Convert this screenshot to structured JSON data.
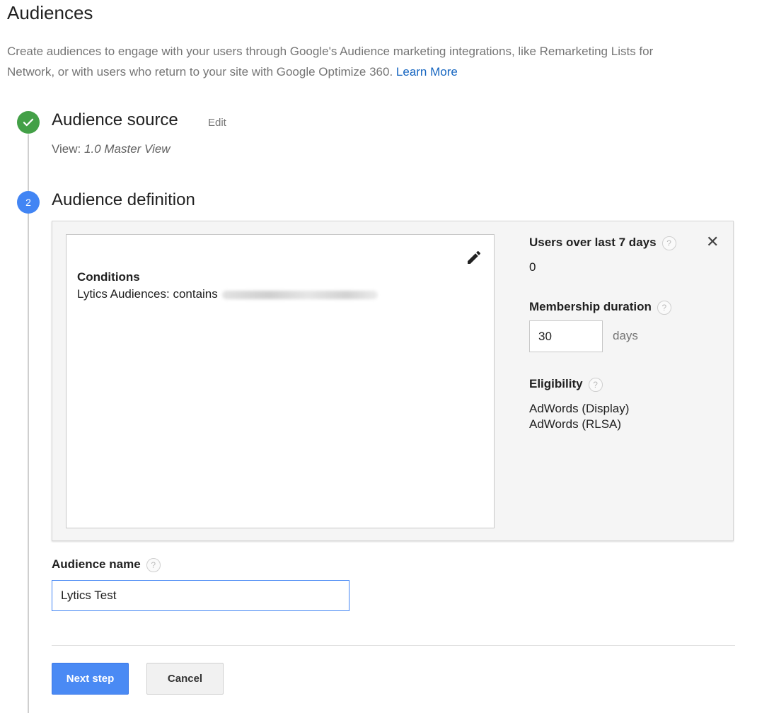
{
  "page": {
    "title": "Audiences",
    "intro_line1": "Create audiences to engage with your users through Google's Audience marketing integrations, like Remarketing Lists for",
    "intro_line2": "Network, or with users who return to your site with Google Optimize 360.",
    "learn_more": "Learn More"
  },
  "step1": {
    "title": "Audience source",
    "edit_label": "Edit",
    "view_prefix": "View:",
    "view_name": "1.0 Master View",
    "icon": "check-icon"
  },
  "step2": {
    "number": "2",
    "title": "Audience definition",
    "conditions_title": "Conditions",
    "conditions_text": "Lytics Audiences: contains",
    "users_label": "Users over last 7 days",
    "users_value": "0",
    "membership_label": "Membership duration",
    "membership_value": "30",
    "days_label": "days",
    "eligibility_label": "Eligibility",
    "eligibility": [
      "AdWords (Display)",
      "AdWords (RLSA)"
    ],
    "help_glyph": "?",
    "close_glyph": "✕"
  },
  "audience_name": {
    "label": "Audience name",
    "value": "Lytics Test"
  },
  "buttons": {
    "next": "Next step",
    "cancel": "Cancel"
  },
  "colors": {
    "accent": "#4285f4",
    "success": "#43a047",
    "link": "#1565c0"
  }
}
